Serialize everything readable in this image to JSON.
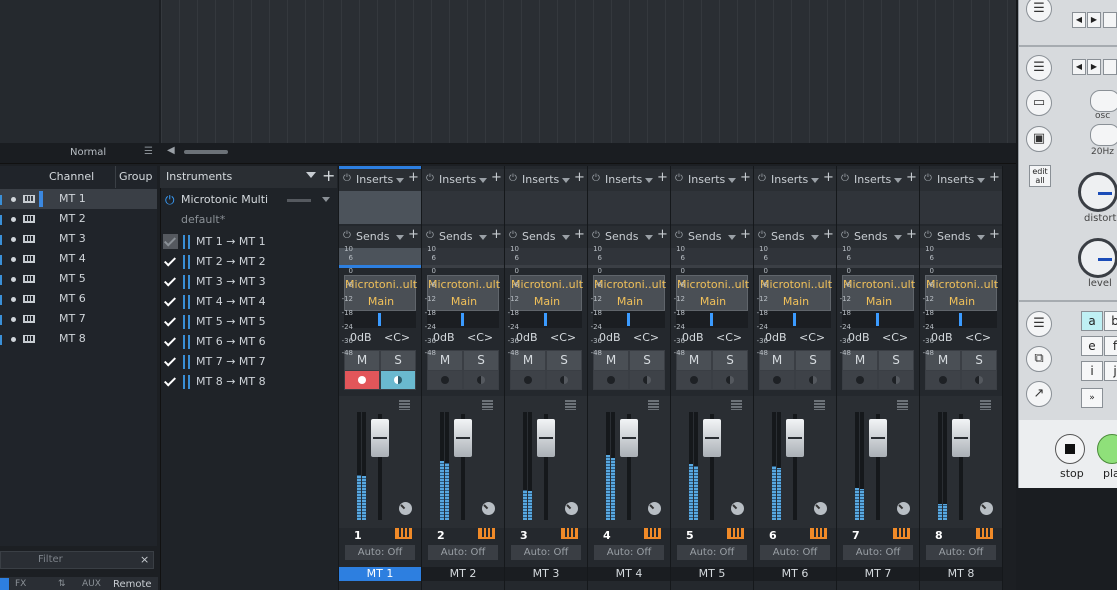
{
  "arrangement": {
    "timebase_mode": "Normal"
  },
  "channel_list": {
    "headers": {
      "channel": "Channel",
      "group": "Group"
    },
    "channels": [
      "MT 1",
      "MT 2",
      "MT 3",
      "MT 4",
      "MT 5",
      "MT 6",
      "MT 7",
      "MT 8"
    ],
    "selected_index": 0,
    "filter_placeholder": "Filter",
    "filter_clear": "×",
    "bottom_tabs": [
      "FX",
      "AUX",
      "Remote"
    ]
  },
  "instruments": {
    "title": "Instruments",
    "add": "+",
    "plugin": {
      "name": "Microtonic Multi",
      "preset": "default*"
    },
    "routes": [
      "MT 1 → MT 1",
      "MT 2 → MT 2",
      "MT 3 → MT 3",
      "MT 4 → MT 4",
      "MT 5 → MT 5",
      "MT 6 → MT 6",
      "MT 7 → MT 7",
      "MT 8 → MT 8"
    ]
  },
  "mixer": {
    "inserts_label": "Inserts",
    "sends_label": "Sends",
    "plus": "+",
    "mute_label": "M",
    "solo_label": "S",
    "scale": [
      "10",
      "6",
      "0",
      "-6",
      "-12",
      "-18",
      "-24",
      "-36",
      "-48"
    ],
    "strips": [
      {
        "name": "MT 1",
        "number": "1",
        "io_top": "Microtoni..ulti",
        "io_bottom": "Main",
        "volume": "0dB",
        "pan": "<C>",
        "automation": "Auto: Off",
        "meter_level": 0.42,
        "selected": true
      },
      {
        "name": "MT 2",
        "number": "2",
        "io_top": "Microtoni..ulti",
        "io_bottom": "Main",
        "volume": "0dB",
        "pan": "<C>",
        "automation": "Auto: Off",
        "meter_level": 0.55,
        "selected": false
      },
      {
        "name": "MT 3",
        "number": "3",
        "io_top": "Microtoni..ulti",
        "io_bottom": "Main",
        "volume": "0dB",
        "pan": "<C>",
        "automation": "Auto: Off",
        "meter_level": 0.28,
        "selected": false
      },
      {
        "name": "MT 4",
        "number": "4",
        "io_top": "Microtoni..ulti",
        "io_bottom": "Main",
        "volume": "0dB",
        "pan": "<C>",
        "automation": "Auto: Off",
        "meter_level": 0.6,
        "selected": false
      },
      {
        "name": "MT 5",
        "number": "5",
        "io_top": "Microtoni..ulti",
        "io_bottom": "Main",
        "volume": "0dB",
        "pan": "<C>",
        "automation": "Auto: Off",
        "meter_level": 0.52,
        "selected": false
      },
      {
        "name": "MT 6",
        "number": "6",
        "io_top": "Microtoni..ulti",
        "io_bottom": "Main",
        "volume": "0dB",
        "pan": "<C>",
        "automation": "Auto: Off",
        "meter_level": 0.5,
        "selected": false
      },
      {
        "name": "MT 7",
        "number": "7",
        "io_top": "Microtoni..ulti",
        "io_bottom": "Main",
        "volume": "0dB",
        "pan": "<C>",
        "automation": "Auto: Off",
        "meter_level": 0.3,
        "selected": false
      },
      {
        "name": "MT 8",
        "number": "8",
        "io_top": "Microtoni..ulti",
        "io_bottom": "Main",
        "volume": "0dB",
        "pan": "<C>",
        "automation": "Auto: Off",
        "meter_level": 0.15,
        "selected": false
      }
    ]
  },
  "device_panel": {
    "labels": {
      "osc": "osc",
      "hz": "20Hz",
      "edit": "edit",
      "all": "all",
      "distort": "distort",
      "level": "level",
      "stop": "stop",
      "play": "pla"
    },
    "pattern_buttons": [
      "a",
      "b",
      "e",
      "f",
      "i",
      "j"
    ]
  },
  "colors": {
    "accent": "#2d7fe0",
    "record": "#e2565a",
    "monitor": "#6ab9cf",
    "io_text": "#f0c05a",
    "meter": "#58a8e0",
    "piano": "#f08a28"
  }
}
